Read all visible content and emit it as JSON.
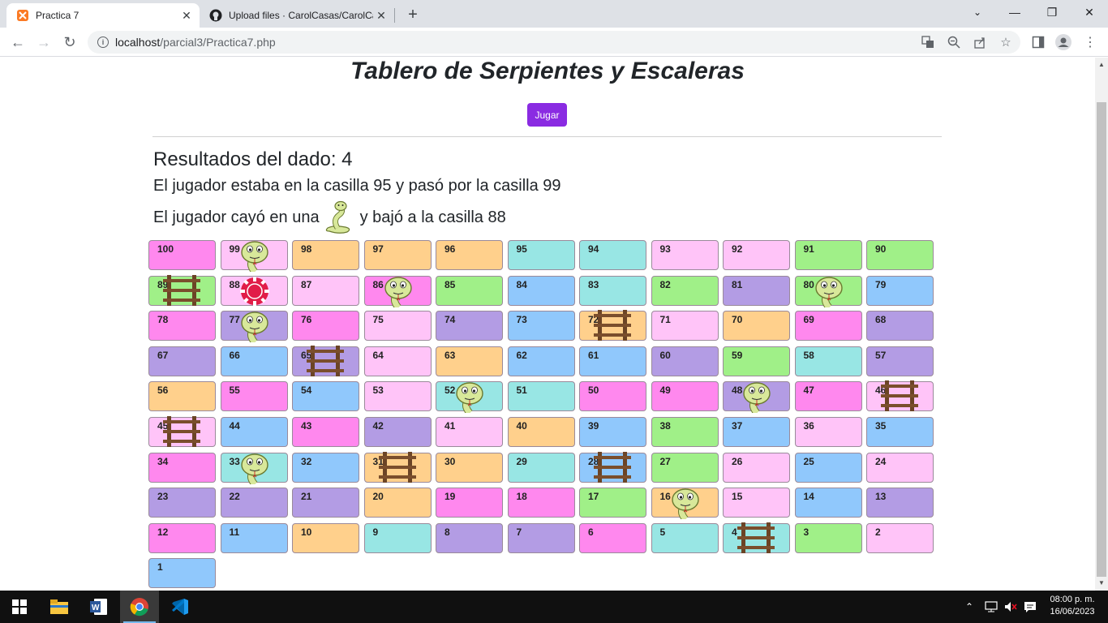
{
  "browser": {
    "tabs": [
      {
        "title": "Practica 7",
        "active": true
      },
      {
        "title": "Upload files · CarolCasas/CarolCa",
        "active": false
      }
    ],
    "url_host": "localhost",
    "url_path": "/parcial3/Practica7.php",
    "window_controls": {
      "minimize": "—",
      "maximize": "❐",
      "close": "✕"
    }
  },
  "page": {
    "title": "Tablero de Serpientes y Escaleras",
    "play_button": "Jugar",
    "dice_result": "Resultados del dado: 4",
    "move_text": "El jugador estaba en la casilla 95 y pasó por la casilla 99",
    "fall_prefix": "El jugador cayó en una",
    "fall_suffix": "y bajó a la casilla 88"
  },
  "board": {
    "rows": [
      [
        100,
        99,
        98,
        97,
        96,
        95,
        94,
        93,
        92,
        91,
        90
      ],
      [
        89,
        88,
        87,
        86,
        85,
        84,
        83,
        82,
        81,
        80,
        79
      ],
      [
        78,
        77,
        76,
        75,
        74,
        73,
        72,
        71,
        70,
        69,
        68
      ],
      [
        67,
        66,
        65,
        64,
        63,
        62,
        61,
        60,
        59,
        58,
        57
      ],
      [
        56,
        55,
        54,
        53,
        52,
        51,
        50,
        49,
        48,
        47,
        46
      ],
      [
        45,
        44,
        43,
        42,
        41,
        40,
        39,
        38,
        37,
        36,
        35
      ],
      [
        34,
        33,
        32,
        31,
        30,
        29,
        28,
        27,
        26,
        25,
        24
      ],
      [
        23,
        22,
        21,
        20,
        19,
        18,
        17,
        16,
        15,
        14,
        13
      ],
      [
        12,
        11,
        10,
        9,
        8,
        7,
        6,
        5,
        4,
        3,
        2
      ],
      [
        1
      ]
    ],
    "colors": {
      "100": "#ff88ee",
      "99": "#ffc4f8",
      "98": "#ffd08c",
      "97": "#ffd08c",
      "96": "#ffd08c",
      "95": "#98e6e4",
      "94": "#98e6e4",
      "93": "#ffc4f8",
      "92": "#ffc4f8",
      "91": "#a0f088",
      "90": "#a0f088",
      "89": "#a0f088",
      "88": "#ffc4f8",
      "87": "#ffc4f8",
      "86": "#ff88ee",
      "85": "#a0f088",
      "84": "#90c8fc",
      "83": "#98e6e4",
      "82": "#a0f088",
      "81": "#b39ce4",
      "80": "#a0f088",
      "79": "#90c8fc",
      "78": "#ff88ee",
      "77": "#b39ce4",
      "76": "#ff88ee",
      "75": "#ffc4f8",
      "74": "#b39ce4",
      "73": "#90c8fc",
      "72": "#ffd08c",
      "71": "#ffc4f8",
      "70": "#ffd08c",
      "69": "#ff88ee",
      "68": "#b39ce4",
      "67": "#b39ce4",
      "66": "#90c8fc",
      "65": "#b39ce4",
      "64": "#ffc4f8",
      "63": "#ffd08c",
      "62": "#90c8fc",
      "61": "#90c8fc",
      "60": "#b39ce4",
      "59": "#a0f088",
      "58": "#98e6e4",
      "57": "#b39ce4",
      "56": "#ffd08c",
      "55": "#ff88ee",
      "54": "#90c8fc",
      "53": "#ffc4f8",
      "52": "#98e6e4",
      "51": "#98e6e4",
      "50": "#ff88ee",
      "49": "#ff88ee",
      "48": "#b39ce4",
      "47": "#ff88ee",
      "46": "#ffc4f8",
      "45": "#ffc4f8",
      "44": "#90c8fc",
      "43": "#ff88ee",
      "42": "#b39ce4",
      "41": "#ffc4f8",
      "40": "#ffd08c",
      "39": "#90c8fc",
      "38": "#a0f088",
      "37": "#90c8fc",
      "36": "#ffc4f8",
      "35": "#90c8fc",
      "34": "#ff88ee",
      "33": "#98e6e4",
      "32": "#90c8fc",
      "31": "#ffd08c",
      "30": "#ffd08c",
      "29": "#98e6e4",
      "28": "#90c8fc",
      "27": "#a0f088",
      "26": "#ffc4f8",
      "25": "#90c8fc",
      "24": "#ffc4f8",
      "23": "#b39ce4",
      "22": "#b39ce4",
      "21": "#b39ce4",
      "20": "#ffd08c",
      "19": "#ff88ee",
      "18": "#ff88ee",
      "17": "#a0f088",
      "16": "#ffd08c",
      "15": "#ffc4f8",
      "14": "#90c8fc",
      "13": "#b39ce4",
      "12": "#ff88ee",
      "11": "#90c8fc",
      "10": "#ffd08c",
      "9": "#98e6e4",
      "8": "#b39ce4",
      "7": "#b39ce4",
      "6": "#ff88ee",
      "5": "#98e6e4",
      "4": "#98e6e4",
      "3": "#a0f088",
      "2": "#ffc4f8",
      "1": "#90c8fc"
    },
    "snakes": [
      99,
      86,
      80,
      77,
      52,
      48,
      33,
      16
    ],
    "ladders": [
      89,
      72,
      65,
      46,
      45,
      31,
      28,
      4
    ],
    "player": [
      88
    ]
  },
  "taskbar": {
    "time": "08:00 p. m.",
    "date": "16/06/2023"
  }
}
